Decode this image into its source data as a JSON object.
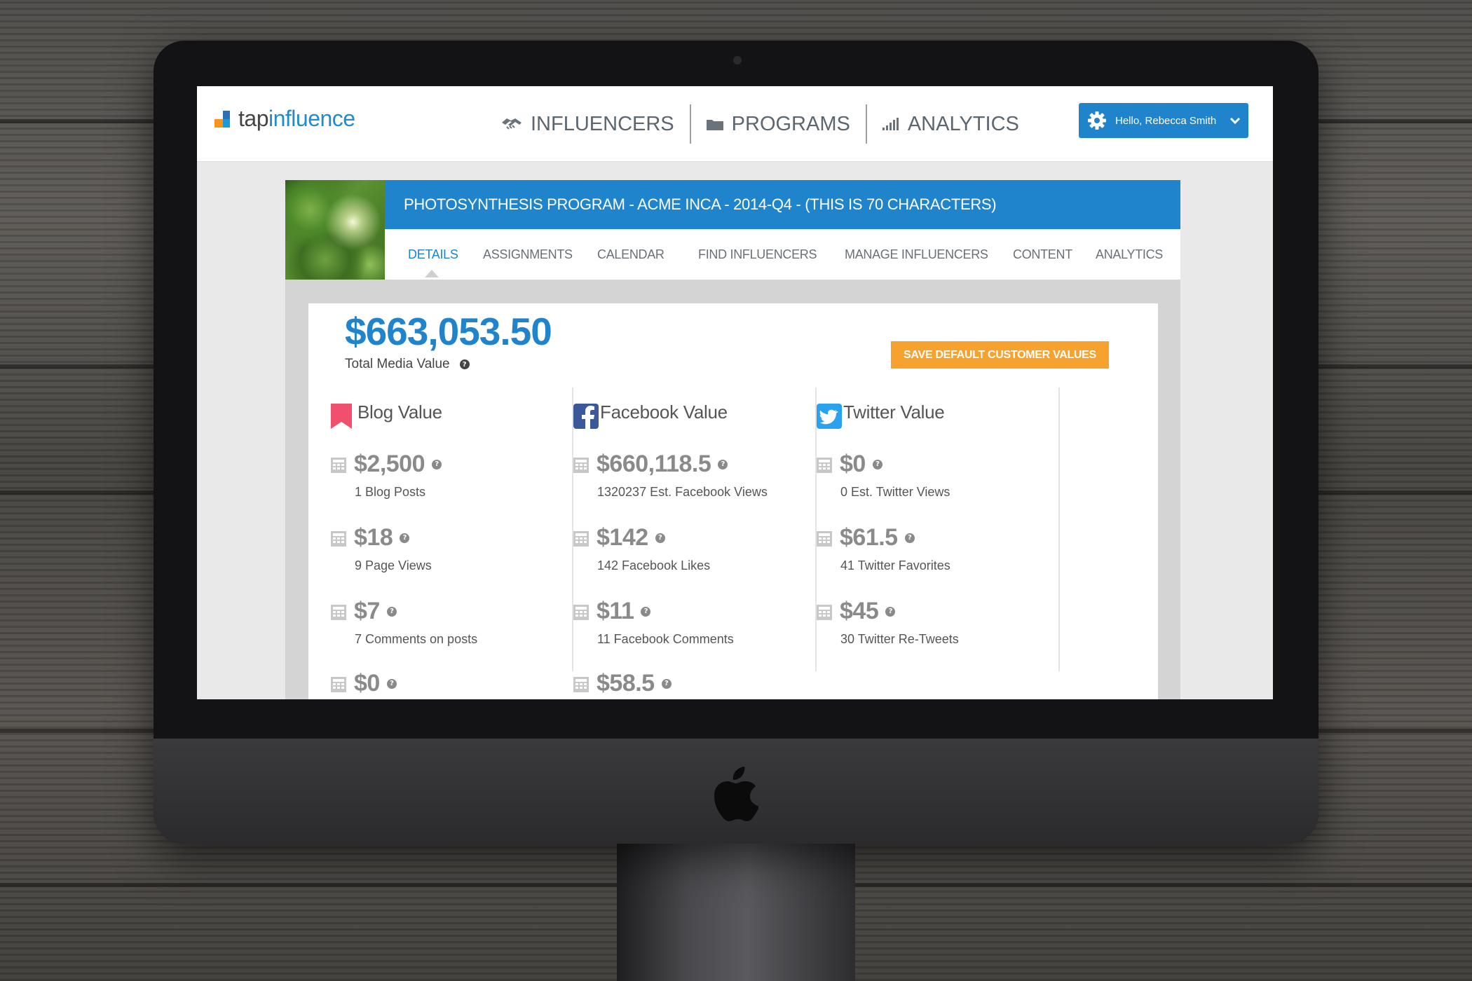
{
  "brand": {
    "logo_prefix": "tap",
    "logo_suffix": "influence"
  },
  "nav": {
    "items": [
      {
        "label": "INFLUENCERS",
        "icon": "handshake-icon"
      },
      {
        "label": "PROGRAMS",
        "icon": "folder-icon"
      },
      {
        "label": "ANALYTICS",
        "icon": "signal-bars-icon"
      }
    ]
  },
  "user_menu": {
    "greeting": "Hello, Rebecca Smith"
  },
  "program": {
    "title": "PHOTOSYNTHESIS PROGRAM - ACME INCA - 2014-Q4 - (THIS IS 70 CHARACTERS)",
    "tabs": [
      "DETAILS",
      "ASSIGNMENTS",
      "CALENDAR",
      "FIND INFLUENCERS",
      "MANAGE INFLUENCERS",
      "CONTENT",
      "ANALYTICS"
    ],
    "active_tab": "DETAILS"
  },
  "summary": {
    "total_value": "$663,053.50",
    "total_label": "Total Media Value",
    "save_button": "SAVE DEFAULT CUSTOMER VALUES"
  },
  "columns": [
    {
      "title": "Blog Value",
      "icon": "bookmark-icon",
      "color": "#f0506e",
      "metrics": [
        {
          "value": "$2,500",
          "desc": "1 Blog Posts"
        },
        {
          "value": "$18",
          "desc": "9 Page Views"
        },
        {
          "value": "$7",
          "desc": "7 Comments on posts"
        },
        {
          "value": "$0",
          "desc": ""
        }
      ]
    },
    {
      "title": "Facebook Value",
      "icon": "facebook-icon",
      "color": "#3b5998",
      "metrics": [
        {
          "value": "$660,118.5",
          "desc": "1320237 Est. Facebook Views"
        },
        {
          "value": "$142",
          "desc": "142 Facebook Likes"
        },
        {
          "value": "$11",
          "desc": "11 Facebook Comments"
        },
        {
          "value": "$58.5",
          "desc": ""
        }
      ]
    },
    {
      "title": "Twitter Value",
      "icon": "twitter-icon",
      "color": "#2aa3ef",
      "metrics": [
        {
          "value": "$0",
          "desc": "0 Est. Twitter Views"
        },
        {
          "value": "$61.5",
          "desc": "41 Twitter Favorites"
        },
        {
          "value": "$45",
          "desc": "30 Twitter Re-Tweets"
        }
      ]
    }
  ],
  "colors": {
    "accent": "#1f84cc",
    "cta": "#f7a12e",
    "muted_value": "#8a8a8a"
  }
}
